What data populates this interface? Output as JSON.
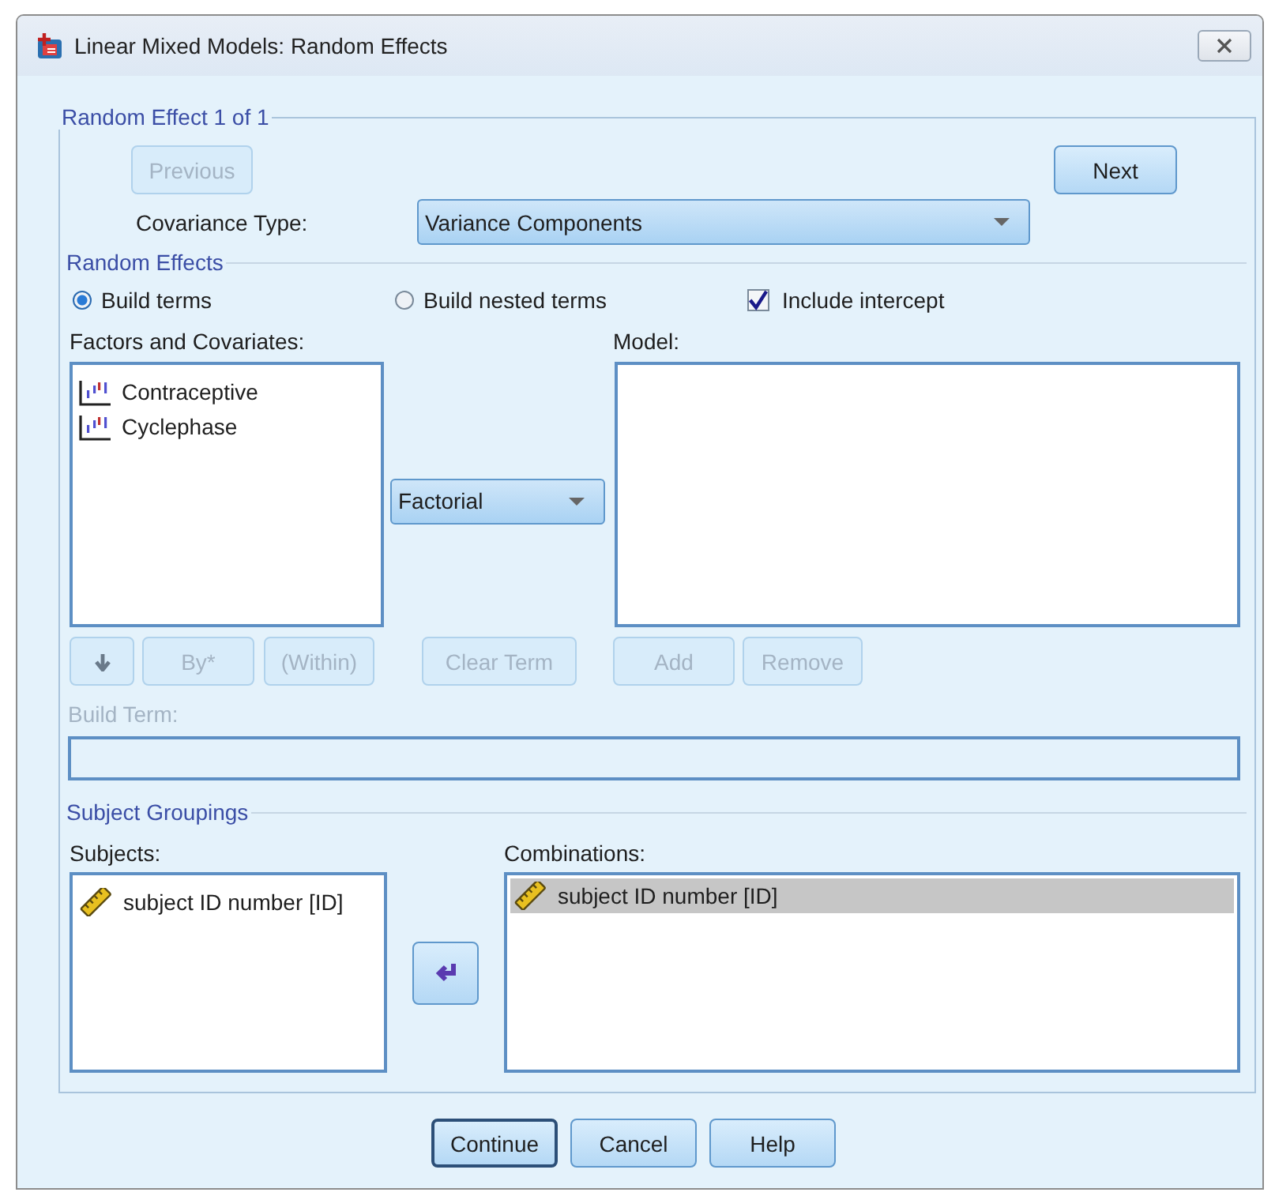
{
  "window": {
    "title": "Linear Mixed Models: Random Effects"
  },
  "random_effect": {
    "legend": "Random Effect 1 of 1",
    "previous": {
      "label": "Previous",
      "disabled": true
    },
    "next": {
      "label": "Next",
      "disabled": false
    },
    "covariance_label": "Covariance Type:",
    "covariance_value": "Variance Components"
  },
  "random_effects": {
    "legend": "Random Effects",
    "options": [
      {
        "kind": "radio",
        "label": "Build terms",
        "selected": true
      },
      {
        "kind": "radio",
        "label": "Build nested terms",
        "selected": false
      },
      {
        "kind": "checkbox",
        "label": "Include intercept",
        "checked": true
      }
    ],
    "factors_label": "Factors and Covariates:",
    "factors": [
      {
        "label": "Contraceptive"
      },
      {
        "label": "Cyclephase"
      }
    ],
    "term_type": "Factorial",
    "model_label": "Model:",
    "term_buttons": [
      {
        "kind": "arrow",
        "disabled": true
      },
      {
        "kind": "text",
        "label": "By*",
        "disabled": true
      },
      {
        "kind": "text",
        "label": "(Within)",
        "disabled": true
      },
      {
        "kind": "text",
        "label": "Clear Term",
        "disabled": true
      }
    ],
    "model_buttons": [
      {
        "label": "Add",
        "disabled": true
      },
      {
        "label": "Remove",
        "disabled": true
      }
    ],
    "build_term_label": "Build Term:",
    "build_term_disabled": true
  },
  "subject_groupings": {
    "legend": "Subject Groupings",
    "subjects_label": "Subjects:",
    "subjects": [
      {
        "label": "subject ID number [ID]",
        "selected": false
      }
    ],
    "move_disabled": false,
    "combinations_label": "Combinations:",
    "combinations": [
      {
        "label": "subject ID number [ID]",
        "selected": true
      }
    ]
  },
  "buttons": [
    {
      "label": "Continue",
      "default": true
    },
    {
      "label": "Cancel",
      "default": false
    },
    {
      "label": "Help",
      "default": false
    }
  ]
}
